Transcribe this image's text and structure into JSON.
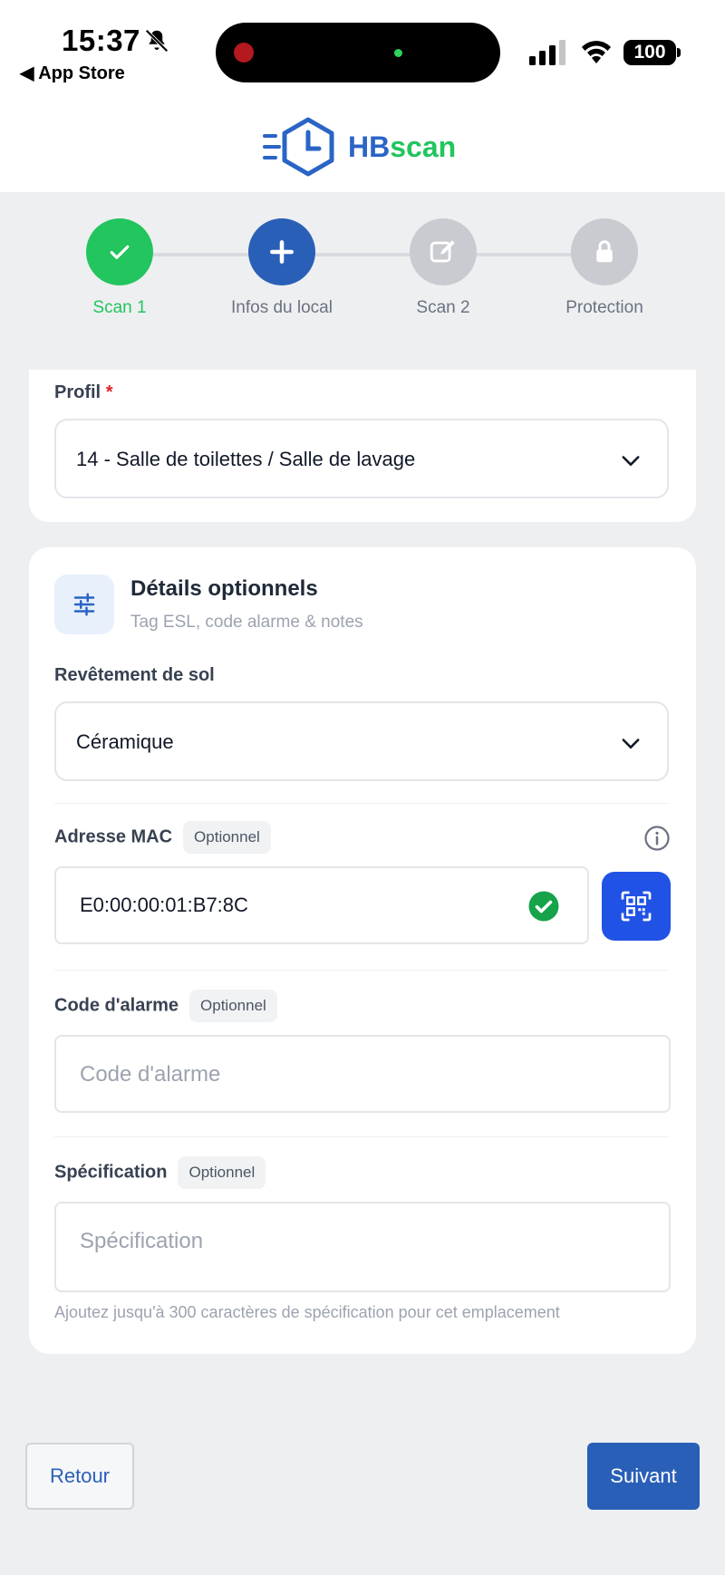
{
  "status_bar": {
    "time": "15:37",
    "back_app": "◀ App Store",
    "battery": "100"
  },
  "header": {
    "logo_hb": "HB",
    "logo_scan": "scan",
    "brand_blue": "#2a64c6",
    "brand_green": "#22c55e"
  },
  "stepper": {
    "steps": [
      {
        "label": "Scan 1",
        "state": "done",
        "icon": "check-icon"
      },
      {
        "label": "Infos du local",
        "state": "active",
        "icon": "plus-icon"
      },
      {
        "label": "Scan 2",
        "state": "pending",
        "icon": "edit-icon"
      },
      {
        "label": "Protection",
        "state": "pending",
        "icon": "lock-icon"
      }
    ]
  },
  "profile": {
    "label": "Profil",
    "required_mark": "*",
    "selected": "14 - Salle de toilettes / Salle de lavage"
  },
  "details": {
    "title": "Détails optionnels",
    "subtitle": "Tag ESL, code alarme & notes",
    "flooring": {
      "label": "Revêtement de sol",
      "selected": "Céramique"
    },
    "mac": {
      "label": "Adresse MAC",
      "badge": "Optionnel",
      "value": "E0:00:00:01:B7:8C"
    },
    "alarm": {
      "label": "Code d'alarme",
      "badge": "Optionnel",
      "placeholder": "Code d'alarme"
    },
    "spec": {
      "label": "Spécification",
      "badge": "Optionnel",
      "placeholder": "Spécification",
      "helper": "Ajoutez jusqu'à 300 caractères de spécification pour cet emplacement"
    }
  },
  "footer": {
    "back_label": "Retour",
    "next_label": "Suivant"
  }
}
